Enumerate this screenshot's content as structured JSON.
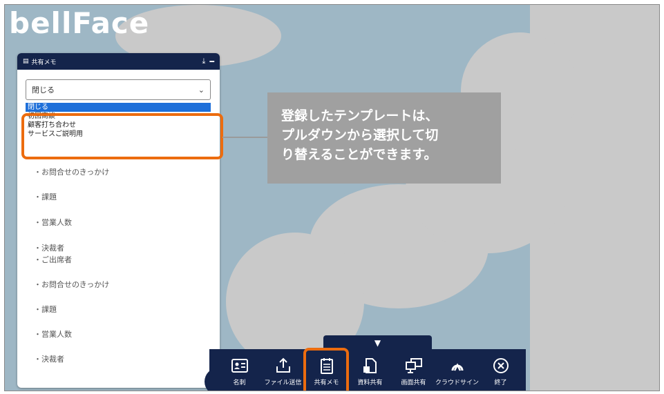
{
  "app": {
    "logo": "bellFace"
  },
  "memo": {
    "title": "共有メモ",
    "select": {
      "value": "閉じる"
    },
    "dropdown_options": [
      {
        "label": "閉じる",
        "selected": true
      },
      {
        "label": "初回商談",
        "selected": false
      },
      {
        "label": "顧客打ち合わせ",
        "selected": false
      },
      {
        "label": "サービスご説明用",
        "selected": false
      }
    ],
    "lines": [
      "・お問合せのきっかけ",
      "・課題",
      "・営業人数",
      "・決裁者",
      "・ご出席者",
      "・お問合せのきっかけ",
      "・課題",
      "・営業人数",
      "・決裁者"
    ]
  },
  "callout": {
    "lines": [
      "登録したテンプレートは、",
      "プルダウンから選択して切",
      "り替えることができます。"
    ]
  },
  "toolbar": {
    "toggle_icon": "▼",
    "items": [
      {
        "label": "名刺",
        "icon": "business-card-icon"
      },
      {
        "label": "ファイル送信",
        "icon": "upload-icon"
      },
      {
        "label": "共有メモ",
        "icon": "memo-icon"
      },
      {
        "label": "資料共有",
        "icon": "document-share-icon"
      },
      {
        "label": "画面共有",
        "icon": "screen-share-icon"
      },
      {
        "label": "クラウドサイン",
        "icon": "cloudsign-icon"
      },
      {
        "label": "終了",
        "icon": "close-circle-icon"
      }
    ]
  },
  "colors": {
    "highlight": "#ec6c0f",
    "navy": "#14244b",
    "callout_bg": "#a0a0a0",
    "selected": "#1e6fd9"
  }
}
